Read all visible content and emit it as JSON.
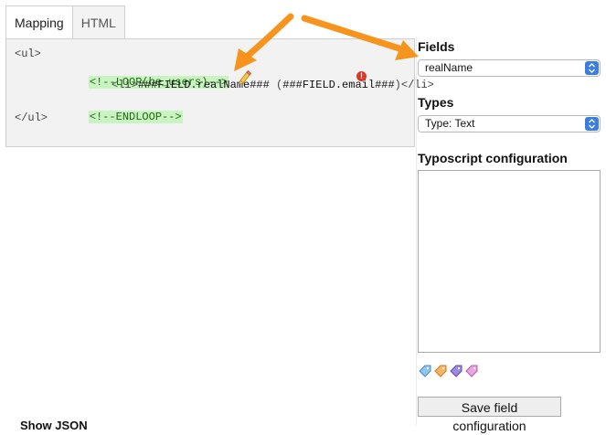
{
  "tabs": [
    {
      "label": "Mapping",
      "active": true
    },
    {
      "label": "HTML",
      "active": false
    }
  ],
  "code": {
    "line1": "<ul>",
    "line2_comment": "<!--LOOP(be_users)-->",
    "line3_open": "<li>",
    "line3_field1": "###FIELD.realName###",
    "line3_mid": " (",
    "line3_field2": "###FIELD.email###",
    "line3_close": ")</li>",
    "line4_comment": "<!--ENDLOOP-->",
    "line5": "</ul>"
  },
  "fields": {
    "heading": "Fields",
    "selected": "realName"
  },
  "types": {
    "heading": "Types",
    "selected": "Type: Text"
  },
  "typoscript": {
    "heading": "Typoscript configuration",
    "value": ""
  },
  "save_button": "Save field configuration",
  "show_json": "Show JSON",
  "icons": {
    "edit": "pencil-icon",
    "error": "error-icon",
    "tags": [
      "tag-blue-icon",
      "tag-orange-icon",
      "tag-purple-icon",
      "tag-pink-icon"
    ]
  },
  "colors": {
    "comment_bg": "#c9f3c1",
    "arrow": "#f7941d",
    "select_chevron": "#3b7de0"
  }
}
